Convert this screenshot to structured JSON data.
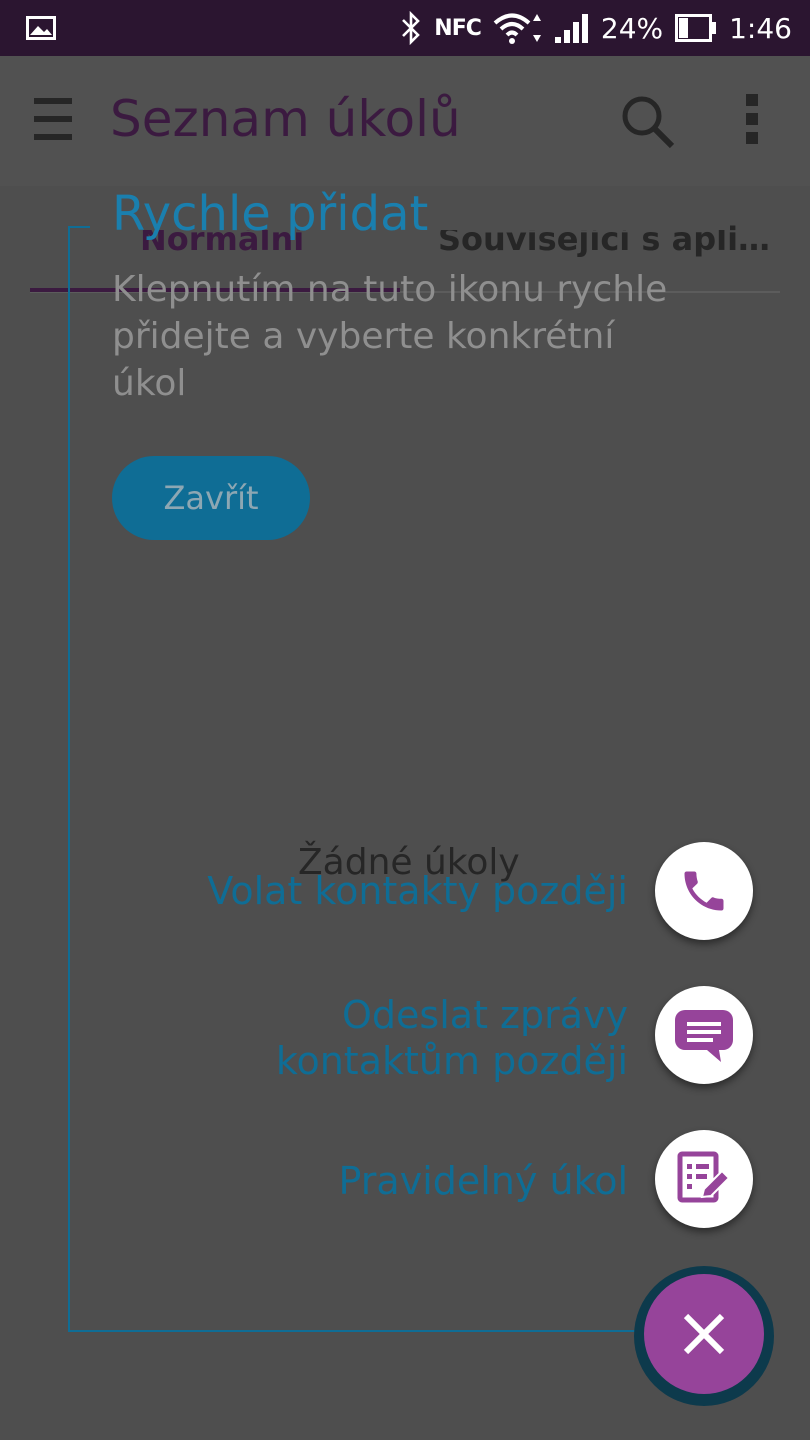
{
  "status_bar": {
    "battery_percent": "24%",
    "time": "1:46",
    "nfc_label": "NFC",
    "icons": [
      "gallery-icon",
      "bluetooth-icon",
      "nfc-icon",
      "wifi-icon",
      "signal-icon",
      "battery-icon"
    ]
  },
  "app_bar": {
    "title": "Seznam úkolů",
    "icons": [
      "menu-icon",
      "search-icon",
      "more-vert-icon"
    ]
  },
  "tabs": [
    {
      "label": "Normální",
      "selected": true
    },
    {
      "label": "Související s apli…",
      "selected": false
    }
  ],
  "empty_state": "Žádné úkoly",
  "coach_mark": {
    "title": "Rychle přidat",
    "description": "Klepnutím na tuto ikonu rychle přidejte a vyberte konkrétní úkol",
    "close_label": "Zavřít"
  },
  "speed_dial": {
    "actions": [
      {
        "label": "Volat kontakty později",
        "icon": "phone-icon"
      },
      {
        "label": "Odeslat zprávy kontaktům později",
        "icon": "message-icon"
      },
      {
        "label": "Pravidelný úkol",
        "icon": "edit-list-icon"
      }
    ],
    "main_icon": "close-icon"
  },
  "colors": {
    "accent": "#96449a",
    "coach_blue": "#0f6d95",
    "overlay": "#4e4e4e",
    "status_bar": "#2b1530"
  }
}
